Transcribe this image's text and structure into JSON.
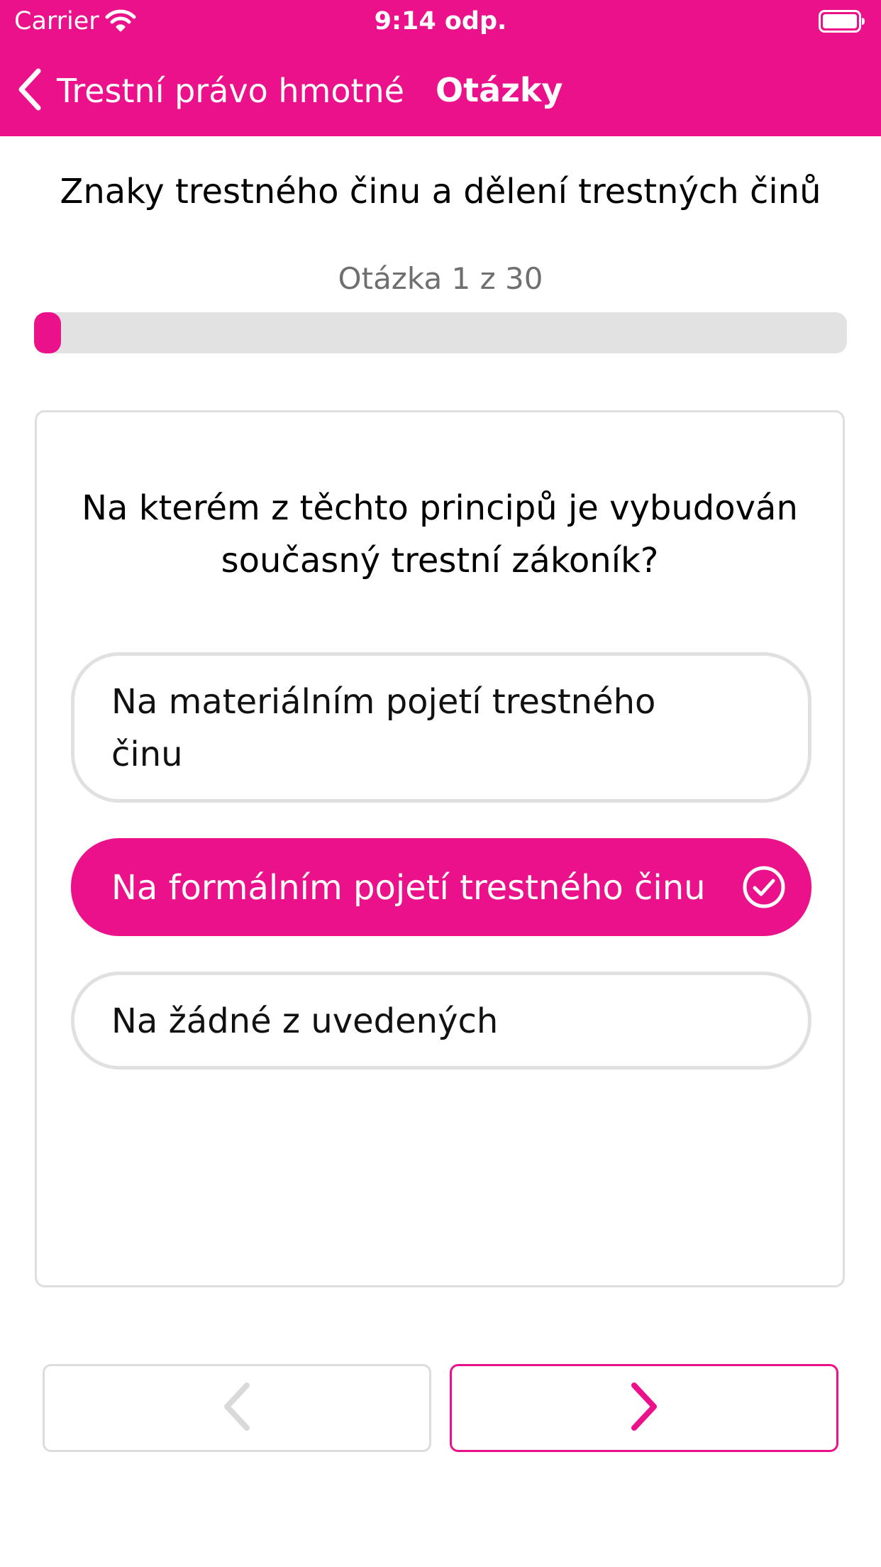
{
  "status_bar": {
    "carrier": "Carrier",
    "time": "9:14 odp."
  },
  "nav": {
    "back_label": "Trestní právo hmotné",
    "title": "Otázky"
  },
  "quiz": {
    "topic": "Znaky trestného činu a dělení trestných činů",
    "counter": "Otázka 1 z 30",
    "progress": 0.0333,
    "question": "Na kterém z těchto principů je vybudován současný trestní zákoník?",
    "answers": [
      {
        "text": "Na materiálním pojetí trestného činu",
        "selected": false
      },
      {
        "text": "Na formálním pojetí trestného činu",
        "selected": true
      },
      {
        "text": "Na žádné z uvedených",
        "selected": false
      }
    ]
  },
  "colors": {
    "accent": "#EB118A",
    "border": "#E0E0E0",
    "counter_text": "#6F6F6F"
  },
  "icons": {
    "back": "chevron-left-icon",
    "check": "check-circle-icon",
    "prev": "chevron-left-icon",
    "next": "chevron-right-icon"
  }
}
